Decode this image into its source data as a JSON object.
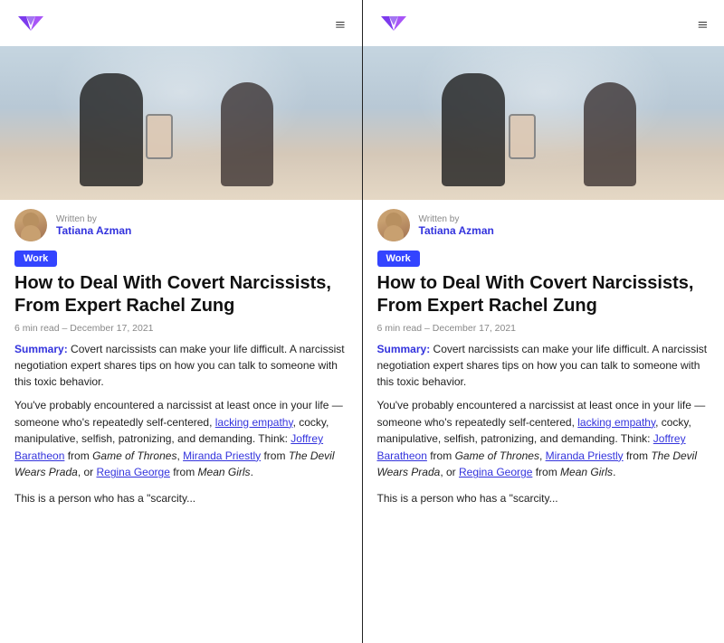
{
  "colors": {
    "brand": "#3344ff",
    "link": "#3333dd",
    "text": "#222222",
    "muted": "#888888",
    "background": "#ffffff",
    "black": "#000000"
  },
  "panels": [
    {
      "id": "panel-left",
      "header": {
        "logo_alt": "brand logo",
        "menu_alt": "hamburger menu"
      },
      "author": {
        "written_by": "Written by",
        "name": "Tatiana Azman"
      },
      "tag": "Work",
      "title": "How to Deal With Covert Narcissists, From Expert Rachel Zung",
      "meta": "6 min read  –  December 17, 2021",
      "summary_label": "Summary:",
      "summary_text": " Covert narcissists can make your life difficult. A narcissist negotiation expert shares tips on how you can talk to someone with this toxic behavior.",
      "body1": "You've probably encountered a narcissist at least once in your life — someone who's repeatedly self-centered, ",
      "link1": "lacking empathy",
      "body2": ", cocky, manipulative, selfish, patronizing, and demanding. Think: ",
      "link2": "Joffrey Baratheon",
      "body3": " from ",
      "italic1": "Game of Thrones",
      "body4": ", ",
      "link3": "Miranda Priestly",
      "body5": " from ",
      "italic2": "The Devil Wears Prada",
      "body6": ", or ",
      "link4": "Regina George",
      "body7": " from ",
      "italic3": "Mean Girls",
      "body8": ".",
      "body_last": "This is a person who has a \"scarcity..."
    },
    {
      "id": "panel-right",
      "header": {
        "logo_alt": "brand logo",
        "menu_alt": "hamburger menu"
      },
      "author": {
        "written_by": "Written by",
        "name": "Tatiana Azman"
      },
      "tag": "Work",
      "title": "How to Deal With Covert Narcissists, From Expert Rachel Zung",
      "meta": "6 min read  –  December 17, 2021",
      "summary_label": "Summary:",
      "summary_text": " Covert narcissists can make your life difficult. A narcissist negotiation expert shares tips on how you can talk to someone with this toxic behavior.",
      "body1": "You've probably encountered a narcissist at least once in your life — someone who's repeatedly self-centered, ",
      "link1": "lacking empathy",
      "body2": ", cocky, manipulative, selfish, patronizing, and demanding. Think: ",
      "link2": "Joffrey Baratheon",
      "body3": " from ",
      "italic1": "Game of Thrones",
      "body4": ", ",
      "link3": "Miranda Priestly",
      "body5": " from ",
      "italic2": "The Devil Wears Prada",
      "body6": ", or ",
      "link4": "Regina George",
      "body7": " from ",
      "italic3": "Mean Girls",
      "body8": ".",
      "body_last": "This is a person who has a \"scarcity..."
    }
  ]
}
